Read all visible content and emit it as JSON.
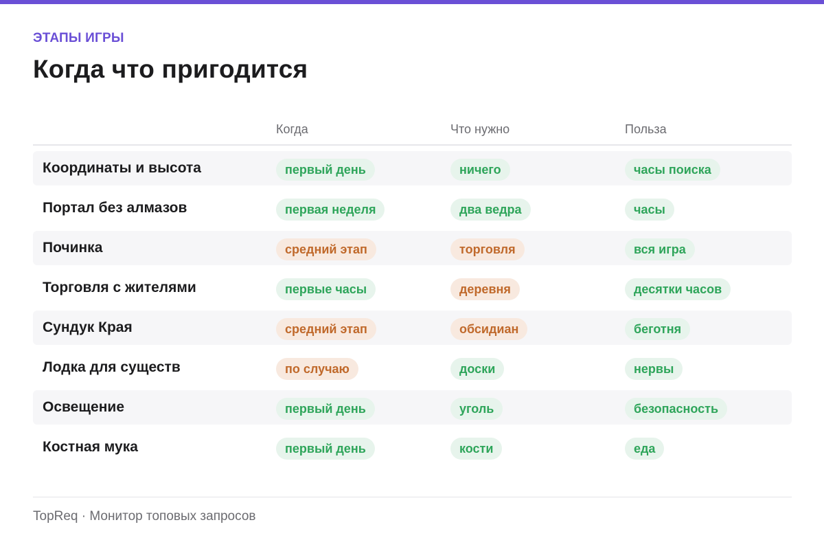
{
  "colors": {
    "accent": "#6a4fd6",
    "green_text": "#2ea55a",
    "green_bg": "#e7f4ec",
    "orange_text": "#c0692b",
    "orange_bg": "#f8e9df"
  },
  "header": {
    "eyebrow": "ЭТАПЫ ИГРЫ",
    "title": "Когда что пригодится"
  },
  "table": {
    "columns": [
      "",
      "Когда",
      "Что нужно",
      "Польза"
    ],
    "rows": [
      {
        "label": "Координаты и высота",
        "when": {
          "text": "первый день",
          "tone": "green"
        },
        "need": {
          "text": "ничего",
          "tone": "green"
        },
        "benefit": {
          "text": "часы поиска",
          "tone": "green"
        }
      },
      {
        "label": "Портал без алмазов",
        "when": {
          "text": "первая неделя",
          "tone": "green"
        },
        "need": {
          "text": "два ведра",
          "tone": "green"
        },
        "benefit": {
          "text": "часы",
          "tone": "green"
        }
      },
      {
        "label": "Починка",
        "when": {
          "text": "средний этап",
          "tone": "orange"
        },
        "need": {
          "text": "торговля",
          "tone": "orange"
        },
        "benefit": {
          "text": "вся игра",
          "tone": "green"
        }
      },
      {
        "label": "Торговля с жителями",
        "when": {
          "text": "первые часы",
          "tone": "green"
        },
        "need": {
          "text": "деревня",
          "tone": "orange"
        },
        "benefit": {
          "text": "десятки часов",
          "tone": "green"
        }
      },
      {
        "label": "Сундук Края",
        "when": {
          "text": "средний этап",
          "tone": "orange"
        },
        "need": {
          "text": "обсидиан",
          "tone": "orange"
        },
        "benefit": {
          "text": "беготня",
          "tone": "green"
        }
      },
      {
        "label": "Лодка для существ",
        "when": {
          "text": "по случаю",
          "tone": "orange"
        },
        "need": {
          "text": "доски",
          "tone": "green"
        },
        "benefit": {
          "text": "нервы",
          "tone": "green"
        }
      },
      {
        "label": "Освещение",
        "when": {
          "text": "первый день",
          "tone": "green"
        },
        "need": {
          "text": "уголь",
          "tone": "green"
        },
        "benefit": {
          "text": "безопасность",
          "tone": "green"
        }
      },
      {
        "label": "Костная мука",
        "when": {
          "text": "первый день",
          "tone": "green"
        },
        "need": {
          "text": "кости",
          "tone": "green"
        },
        "benefit": {
          "text": "еда",
          "tone": "green"
        }
      }
    ]
  },
  "footer": {
    "text": "TopReq · Монитор топовых запросов"
  }
}
